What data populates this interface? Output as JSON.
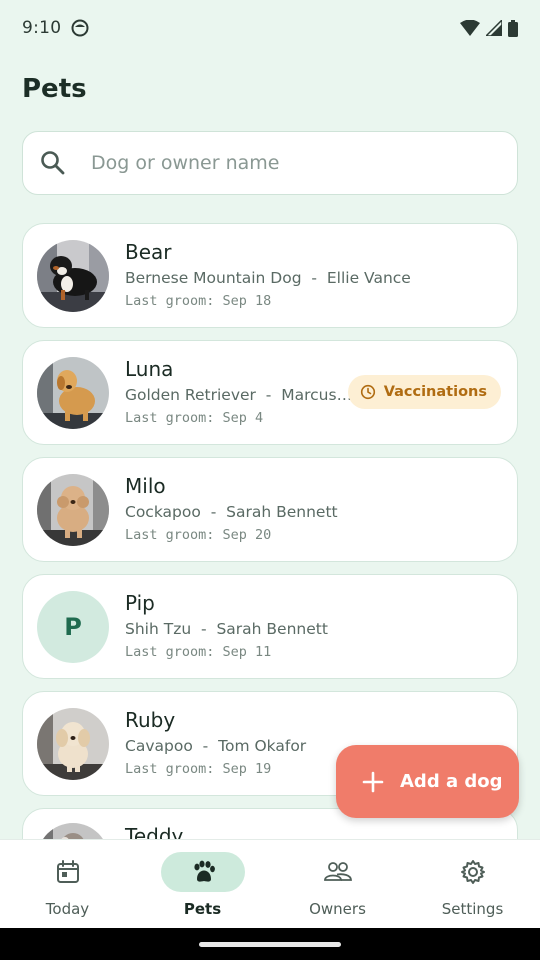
{
  "status_bar": {
    "time": "9:10"
  },
  "header": {
    "title": "Pets"
  },
  "search": {
    "placeholder": "Dog or owner name",
    "value": ""
  },
  "pets": [
    {
      "name": "Bear",
      "breed": "Bernese Mountain Dog",
      "owner": "Ellie Vance",
      "last_groom": "Last groom: Sep 18",
      "avatar": "bernese-photo"
    },
    {
      "name": "Luna",
      "breed": "Golden Retriever",
      "owner": "Marcus ...",
      "last_groom": "Last groom: Sep 4",
      "avatar": "golden-photo",
      "badge": "Vaccinations"
    },
    {
      "name": "Milo",
      "breed": "Cockapoo",
      "owner": "Sarah Bennett",
      "last_groom": "Last groom: Sep 20",
      "avatar": "cockapoo-photo"
    },
    {
      "name": "Pip",
      "breed": "Shih Tzu",
      "owner": "Sarah Bennett",
      "last_groom": "Last groom: Sep 11",
      "avatar_initial": "P"
    },
    {
      "name": "Ruby",
      "breed": "Cavapoo",
      "owner": "Tom Okafor",
      "last_groom": "Last groom: Sep 19",
      "avatar": "cavapoo-photo"
    },
    {
      "name": "Teddy",
      "avatar": "teddy-photo"
    }
  ],
  "fab": {
    "label": "Add a dog",
    "icon": "plus-icon"
  },
  "bottom_nav": [
    {
      "label": "Today",
      "icon": "calendar-icon",
      "active": false
    },
    {
      "label": "Pets",
      "icon": "paw-icon",
      "active": true
    },
    {
      "label": "Owners",
      "icon": "people-icon",
      "active": false
    },
    {
      "label": "Settings",
      "icon": "gear-icon",
      "active": false
    }
  ],
  "colors": {
    "background": "#eaf6ef",
    "accent": "#1f6b4f",
    "fab": "#f07c6a",
    "badge_bg": "#fdefd4",
    "badge_text": "#b06c12",
    "active_pill": "#cdeadc"
  }
}
